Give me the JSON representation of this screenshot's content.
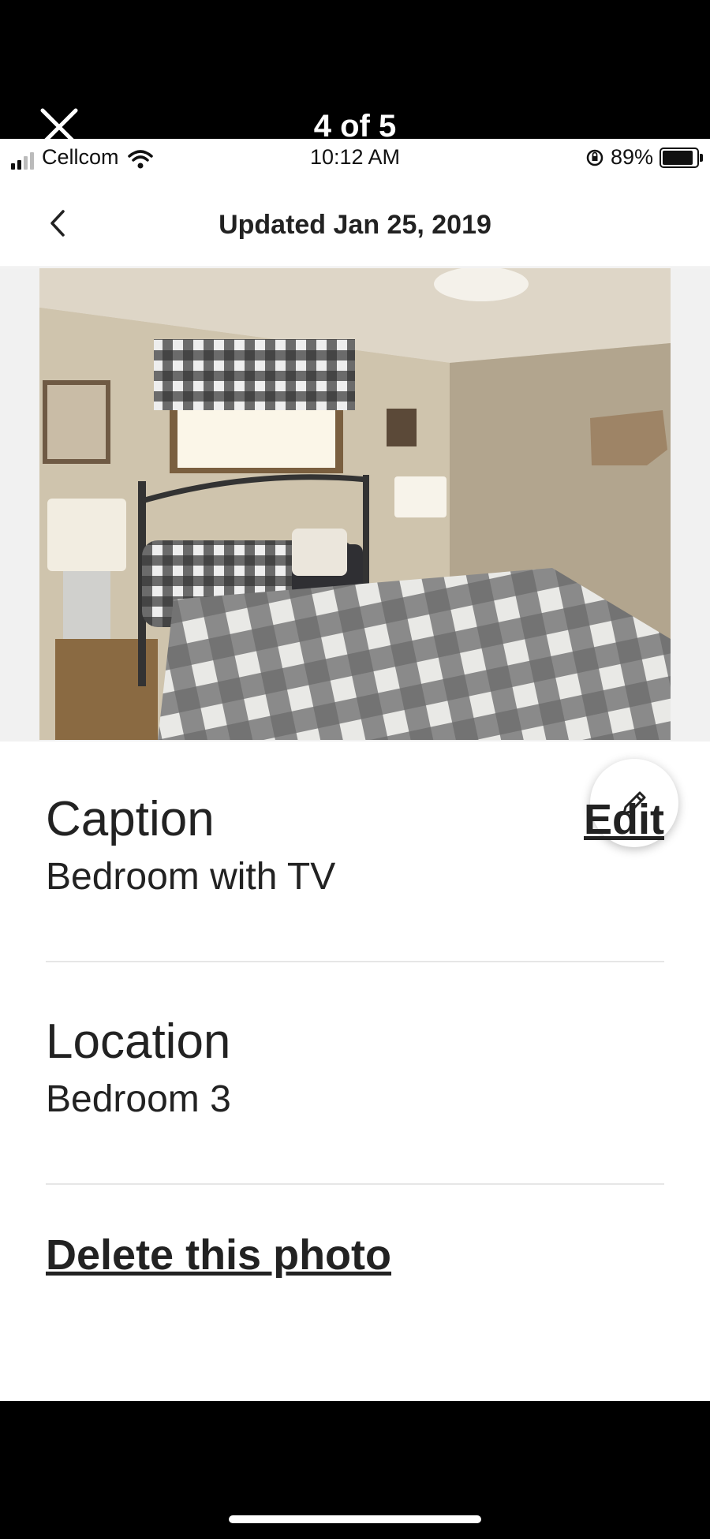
{
  "viewer": {
    "counter": "4 of 5"
  },
  "status_bar": {
    "carrier": "Cellcom",
    "time": "10:12 AM",
    "battery": "89%"
  },
  "nav": {
    "title": "Updated Jan 25, 2019"
  },
  "photo": {
    "description_icon": "bedroom-photo"
  },
  "caption": {
    "heading": "Caption",
    "value": "Bedroom with TV",
    "edit_label": "Edit"
  },
  "location": {
    "heading": "Location",
    "value": "Bedroom 3"
  },
  "actions": {
    "delete_label": "Delete this photo"
  },
  "colors": {
    "text": "#222222",
    "divider": "#e6e6e6"
  }
}
